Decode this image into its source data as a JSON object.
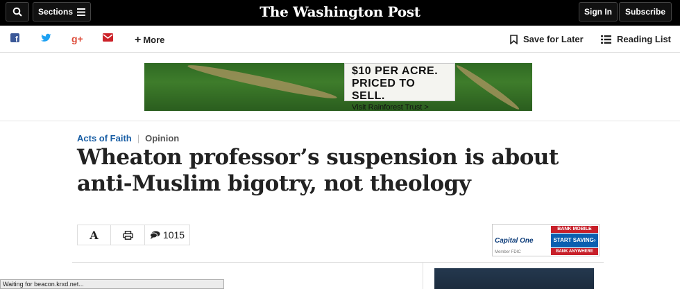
{
  "header": {
    "masthead": "The Washington Post",
    "sections_label": "Sections",
    "sign_in_label": "Sign In",
    "subscribe_label": "Subscribe"
  },
  "sharebar": {
    "more_label": "More",
    "save_label": "Save for Later",
    "reading_list_label": "Reading List",
    "icons": [
      "facebook-icon",
      "twitter-icon",
      "google-plus-icon",
      "email-icon"
    ],
    "colors": {
      "facebook": "#3b5998",
      "twitter": "#1da1f2",
      "google_plus": "#dd4b39",
      "email": "#cc2229"
    }
  },
  "ad_banner": {
    "line1": "$10 PER ACRE.",
    "line2": "PRICED TO SELL.",
    "line3": "Visit Rainforest Trust >"
  },
  "article": {
    "category": "Acts of Faith",
    "label": "Opinion",
    "headline": "Wheaton professor’s suspension is about anti-Muslim bigotry, not theology",
    "font_tool_label": "A",
    "comment_count": "1015"
  },
  "capital_one_ad": {
    "logo": "Capital One",
    "top": "BANK MOBILE",
    "cta": "START SAVING›",
    "bottom": "BANK ANYWHERE",
    "member": "Member FDIC"
  },
  "status_bar": {
    "text": "Waiting for beacon.krxd.net..."
  }
}
